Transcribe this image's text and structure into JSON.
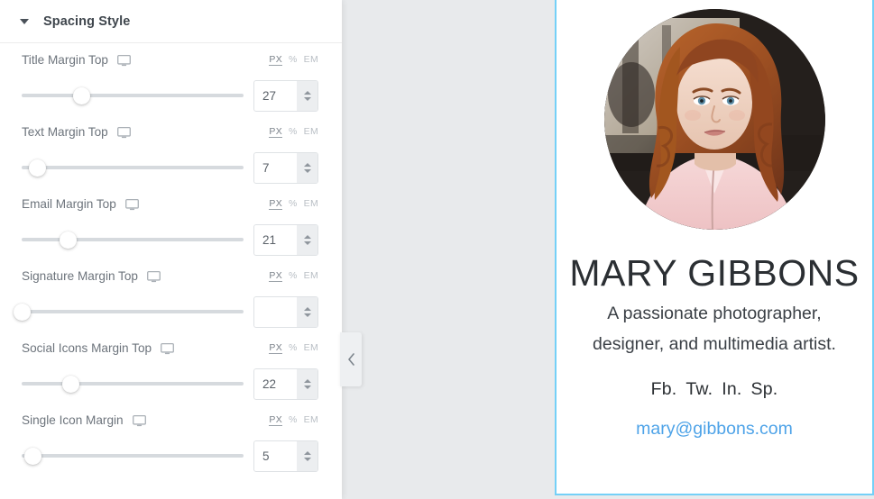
{
  "panel": {
    "title": "Spacing Style",
    "collapse_icon": "caret-down-icon",
    "collapse_handle_icon": "chevron-left-icon",
    "units": [
      "PX",
      "%",
      "EM"
    ],
    "active_unit": "PX",
    "device_icon": "desktop-monitor-icon",
    "rows": [
      {
        "label": "Title Margin Top",
        "value": "27",
        "percent": 27
      },
      {
        "label": "Text Margin Top",
        "value": "7",
        "percent": 7
      },
      {
        "label": "Email Margin Top",
        "value": "21",
        "percent": 21
      },
      {
        "label": "Signature Margin Top",
        "value": "",
        "percent": 0
      },
      {
        "label": "Social Icons Margin Top",
        "value": "22",
        "percent": 22
      },
      {
        "label": "Single Icon Margin",
        "value": "5",
        "percent": 5
      }
    ]
  },
  "preview": {
    "avatar_alt": "portrait-photo",
    "name": "MARY GIBBONS",
    "tagline_line1": "A passionate photographer,",
    "tagline_line2": "designer, and multimedia artist.",
    "social": [
      "Fb.",
      "Tw.",
      "In.",
      "Sp."
    ],
    "email": "mary@gibbons.com"
  },
  "colors": {
    "accent": "#74d0f7",
    "email_link": "#4ea3e8",
    "track": "#d6dade",
    "label": "#6d747c"
  }
}
